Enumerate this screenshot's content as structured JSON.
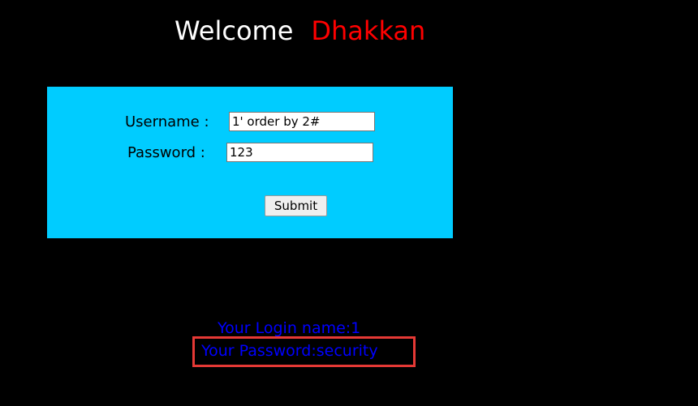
{
  "header": {
    "welcome_label": "Welcome",
    "name_label": "Dhakkan"
  },
  "form": {
    "username_label": "Username :",
    "username_value": "1' order by 2#",
    "password_label": "Password :",
    "password_value": "123",
    "submit_label": "Submit"
  },
  "result": {
    "login_name_text": "Your Login name:1",
    "password_text": "Your Password:security"
  },
  "colors": {
    "background": "#000000",
    "form_background": "#00ccff",
    "welcome_text": "#ffffff",
    "name_text": "#ff0000",
    "result_text": "#0000ff",
    "highlight_border": "#e53935"
  }
}
